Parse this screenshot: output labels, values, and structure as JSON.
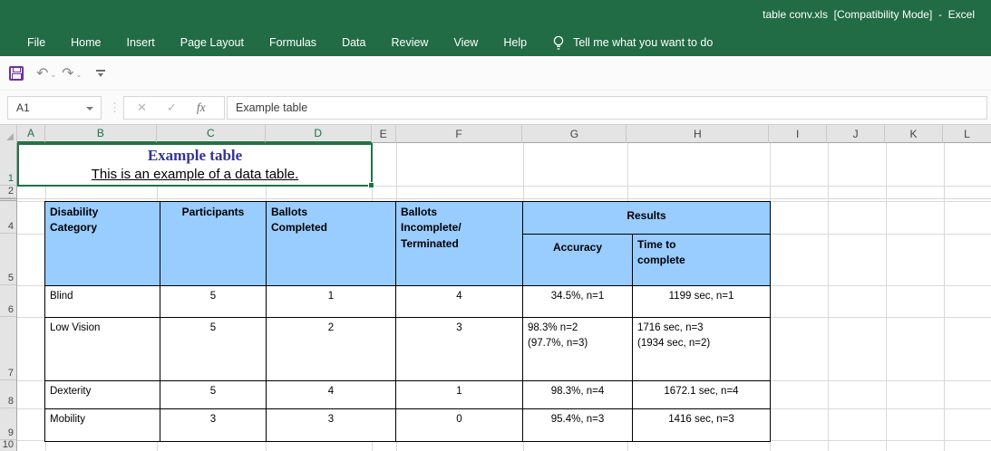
{
  "window": {
    "title": "table conv.xls  [Compatibility Mode]  -  Excel"
  },
  "ribbon": {
    "tabs": [
      "File",
      "Home",
      "Insert",
      "Page Layout",
      "Formulas",
      "Data",
      "Review",
      "View",
      "Help"
    ],
    "tell_me": "Tell me what you want to do"
  },
  "qat": {
    "save": "Save",
    "undo": "Undo",
    "redo": "Redo",
    "customize": "Customize Quick Access Toolbar",
    "undo_glyph": "↶",
    "redo_glyph": "↷"
  },
  "formula_bar": {
    "name_box": "A1",
    "cancel_glyph": "✕",
    "enter_glyph": "✓",
    "function_glyph": "fx",
    "content": "Example table"
  },
  "colors": {
    "ribbon_green": "#216B45",
    "selection_green": "#217346",
    "table_header_fill": "#99CCFF",
    "title_text_blue": "#333399",
    "save_icon_purple": "#7030A0"
  },
  "sheet": {
    "column_headers": [
      "A",
      "B",
      "C",
      "D",
      "E",
      "F",
      "G",
      "H",
      "I",
      "J",
      "K",
      "L"
    ],
    "selected_columns": "A:D",
    "row_headers": [
      "1",
      "2",
      "4",
      "5",
      "6",
      "7",
      "8",
      "9",
      "10"
    ],
    "hidden_row": "3",
    "title_cell": {
      "line1": "Example table",
      "line2": "This is an example of a data table."
    },
    "table": {
      "headers": {
        "category": "Disability\nCategory",
        "participants": "Participants",
        "completed": "Ballots\nCompleted",
        "incomplete": "Ballots\nIncomplete/\nTerminated",
        "results": "Results",
        "accuracy": "Accuracy",
        "time": "Time to\ncomplete"
      },
      "rows": [
        {
          "category": "Blind",
          "participants": "5",
          "completed": "1",
          "incomplete": "4",
          "accuracy": "34.5%, n=1",
          "time": "1199 sec, n=1"
        },
        {
          "category": "Low Vision",
          "participants": "5",
          "completed": "2",
          "incomplete": "3",
          "accuracy": "98.3% n=2\n(97.7%, n=3)",
          "time": "1716 sec, n=3\n(1934 sec, n=2)"
        },
        {
          "category": "Dexterity",
          "participants": "5",
          "completed": "4",
          "incomplete": "1",
          "accuracy": "98.3%, n=4",
          "time": "1672.1 sec, n=4"
        },
        {
          "category": "Mobility",
          "participants": "3",
          "completed": "3",
          "incomplete": "0",
          "accuracy": "95.4%, n=3",
          "time": "1416 sec, n=3"
        }
      ]
    }
  }
}
